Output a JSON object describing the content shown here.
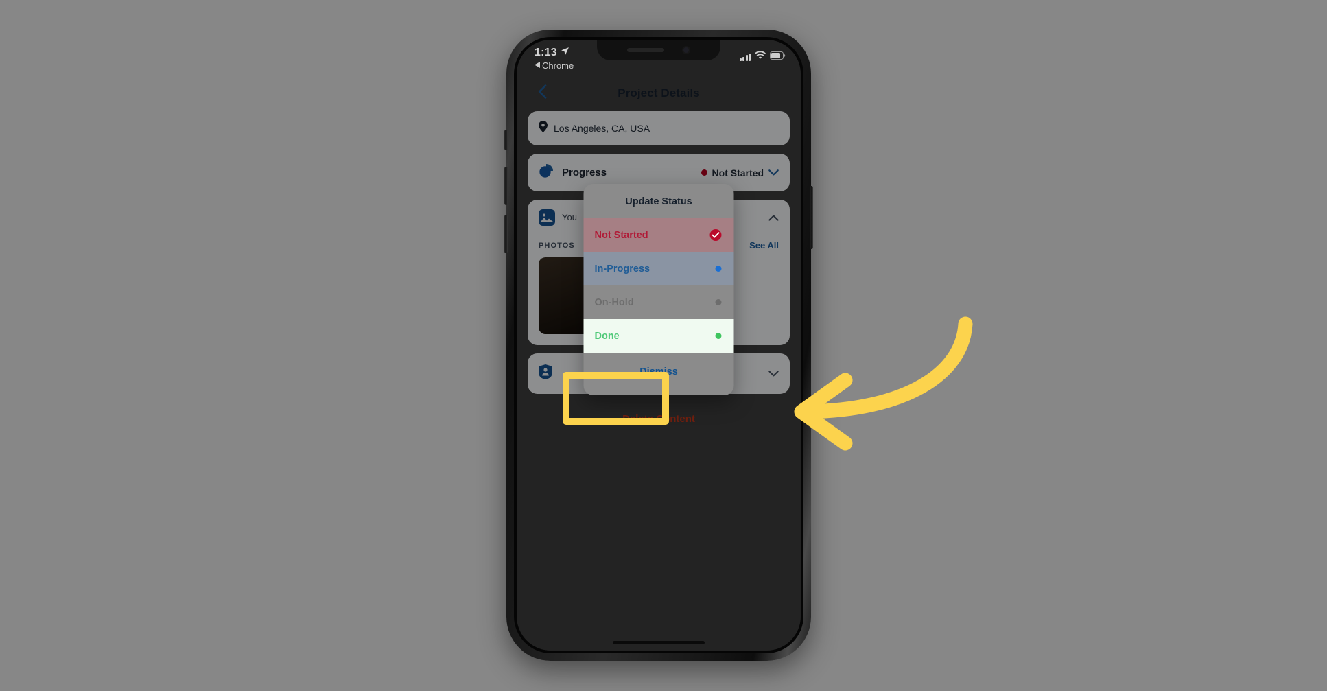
{
  "status_bar": {
    "time": "1:13",
    "location_arrow_icon": "location-arrow-icon",
    "back_app_label": "Chrome",
    "signal_icon": "cellular-signal-icon",
    "wifi_icon": "wifi-icon",
    "battery_icon": "battery-icon"
  },
  "nav": {
    "back_icon": "chevron-left-icon",
    "title": "Project Details"
  },
  "location": {
    "pin_icon": "map-pin-icon",
    "text": "Los Angeles, CA, USA"
  },
  "progress": {
    "chart_icon": "pie-chart-icon",
    "label": "Progress",
    "status_text": "Not Started",
    "status_dot_color": "#b30522",
    "chevron_icon": "chevron-down-icon"
  },
  "photos": {
    "image_icon": "image-icon",
    "owner_text": "You",
    "collapse_icon": "chevron-up-icon",
    "section_label": "PHOTOS",
    "see_all_label": "See All",
    "thumbs": [
      "photo-thumbnail",
      "photo-thumbnail",
      "add-photo-placeholder"
    ]
  },
  "contact": {
    "person_icon": "person-badge-icon",
    "label": "",
    "chevron_icon": "chevron-down-icon"
  },
  "delete": {
    "label": "Delete Content",
    "color": "#c1361b"
  },
  "modal": {
    "title": "Update Status",
    "options": [
      {
        "label": "Not Started",
        "indicator": "check-circle-icon",
        "color": "#b01b37",
        "selected": true
      },
      {
        "label": "In-Progress",
        "indicator": "dot",
        "color": "#1a6fd4",
        "selected": false
      },
      {
        "label": "On-Hold",
        "indicator": "dot",
        "color": "#6d6d6d",
        "selected": false
      },
      {
        "label": "Done",
        "indicator": "dot",
        "color": "#3fc55f",
        "selected": false
      }
    ],
    "dismiss_label": "Dismiss"
  },
  "annotation": {
    "highlight_color": "#FCD34D",
    "arrow_icon": "curved-left-arrow-icon",
    "target": "Done"
  },
  "background_color": "#878787"
}
